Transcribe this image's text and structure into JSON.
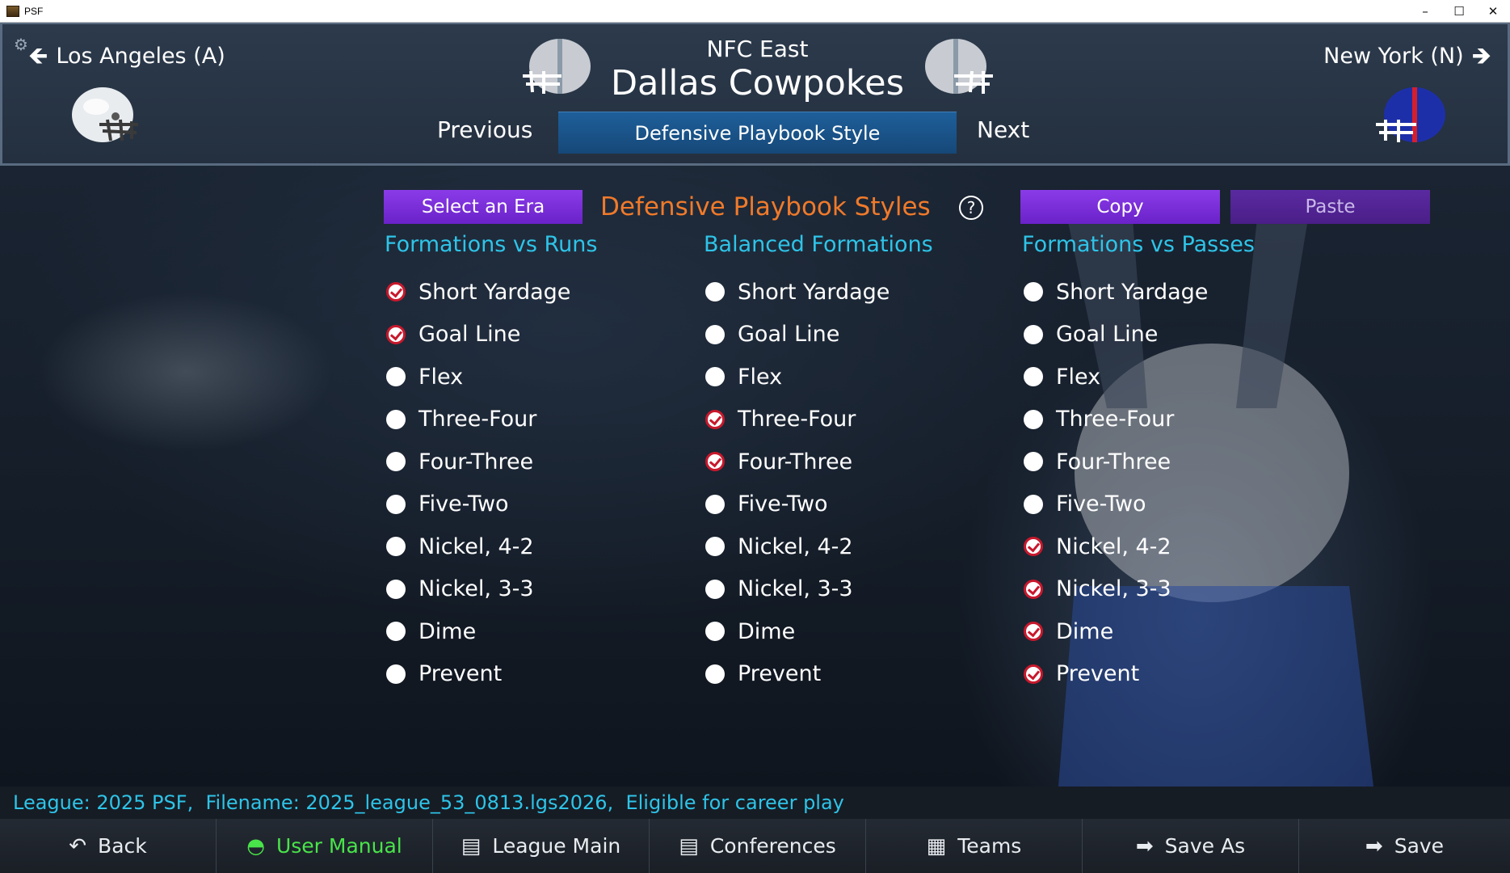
{
  "window": {
    "title": "PSF",
    "controls": [
      "–",
      "☐",
      "✕"
    ]
  },
  "header": {
    "prev_team": "Los Angeles (A)",
    "next_team": "New York (N)",
    "division": "NFC East",
    "team_name": "Dallas Cowpokes",
    "previous_label": "Previous",
    "next_label": "Next",
    "screen_title": "Defensive Playbook Style"
  },
  "toolbar_top": {
    "era_label": "Select an Era",
    "section_title": "Defensive Playbook Styles",
    "help": "?",
    "copy_label": "Copy",
    "paste_label": "Paste"
  },
  "columns": [
    {
      "title": "Formations vs Runs",
      "options": [
        {
          "label": "Short Yardage",
          "checked": true
        },
        {
          "label": "Goal Line",
          "checked": true
        },
        {
          "label": "Flex",
          "checked": false
        },
        {
          "label": "Three-Four",
          "checked": false
        },
        {
          "label": "Four-Three",
          "checked": false
        },
        {
          "label": "Five-Two",
          "checked": false
        },
        {
          "label": "Nickel, 4-2",
          "checked": false
        },
        {
          "label": "Nickel, 3-3",
          "checked": false
        },
        {
          "label": "Dime",
          "checked": false
        },
        {
          "label": "Prevent",
          "checked": false
        }
      ]
    },
    {
      "title": "Balanced Formations",
      "options": [
        {
          "label": "Short Yardage",
          "checked": false
        },
        {
          "label": "Goal Line",
          "checked": false
        },
        {
          "label": "Flex",
          "checked": false
        },
        {
          "label": "Three-Four",
          "checked": true
        },
        {
          "label": "Four-Three",
          "checked": true
        },
        {
          "label": "Five-Two",
          "checked": false
        },
        {
          "label": "Nickel, 4-2",
          "checked": false
        },
        {
          "label": "Nickel, 3-3",
          "checked": false
        },
        {
          "label": "Dime",
          "checked": false
        },
        {
          "label": "Prevent",
          "checked": false
        }
      ]
    },
    {
      "title": "Formations vs Passes",
      "options": [
        {
          "label": "Short Yardage",
          "checked": false
        },
        {
          "label": "Goal Line",
          "checked": false
        },
        {
          "label": "Flex",
          "checked": false
        },
        {
          "label": "Three-Four",
          "checked": false
        },
        {
          "label": "Four-Three",
          "checked": false
        },
        {
          "label": "Five-Two",
          "checked": false
        },
        {
          "label": "Nickel, 4-2",
          "checked": true
        },
        {
          "label": "Nickel, 3-3",
          "checked": true
        },
        {
          "label": "Dime",
          "checked": true
        },
        {
          "label": "Prevent",
          "checked": true
        }
      ]
    }
  ],
  "status": {
    "league": "League: 2025 PSF,",
    "filename": "Filename: 2025_league_53_0813.lgs2026,",
    "career": "Eligible for career play"
  },
  "bottom_nav": [
    {
      "label": "Back",
      "icon": "back-arrow-icon",
      "glyph": "↶",
      "active": false
    },
    {
      "label": "User Manual",
      "icon": "helmet-icon",
      "glyph": "◓",
      "active": true
    },
    {
      "label": "League Main",
      "icon": "clipboard-icon",
      "glyph": "▤",
      "active": false
    },
    {
      "label": "Conferences",
      "icon": "clipboard-icon",
      "glyph": "▤",
      "active": false
    },
    {
      "label": "Teams",
      "icon": "scoreboard-icon",
      "glyph": "▦",
      "active": false
    },
    {
      "label": "Save As",
      "icon": "right-arrow-icon",
      "glyph": "➡",
      "active": false
    },
    {
      "label": "Save",
      "icon": "right-arrow-icon",
      "glyph": "➡",
      "active": false
    }
  ],
  "colors": {
    "accent_orange": "#f07a2a",
    "accent_cyan": "#2ec4e8",
    "button_purple": "#7a2ed8",
    "tab_blue": "#1e5f9a",
    "check_red": "#c8182c",
    "active_green": "#49e34a"
  }
}
